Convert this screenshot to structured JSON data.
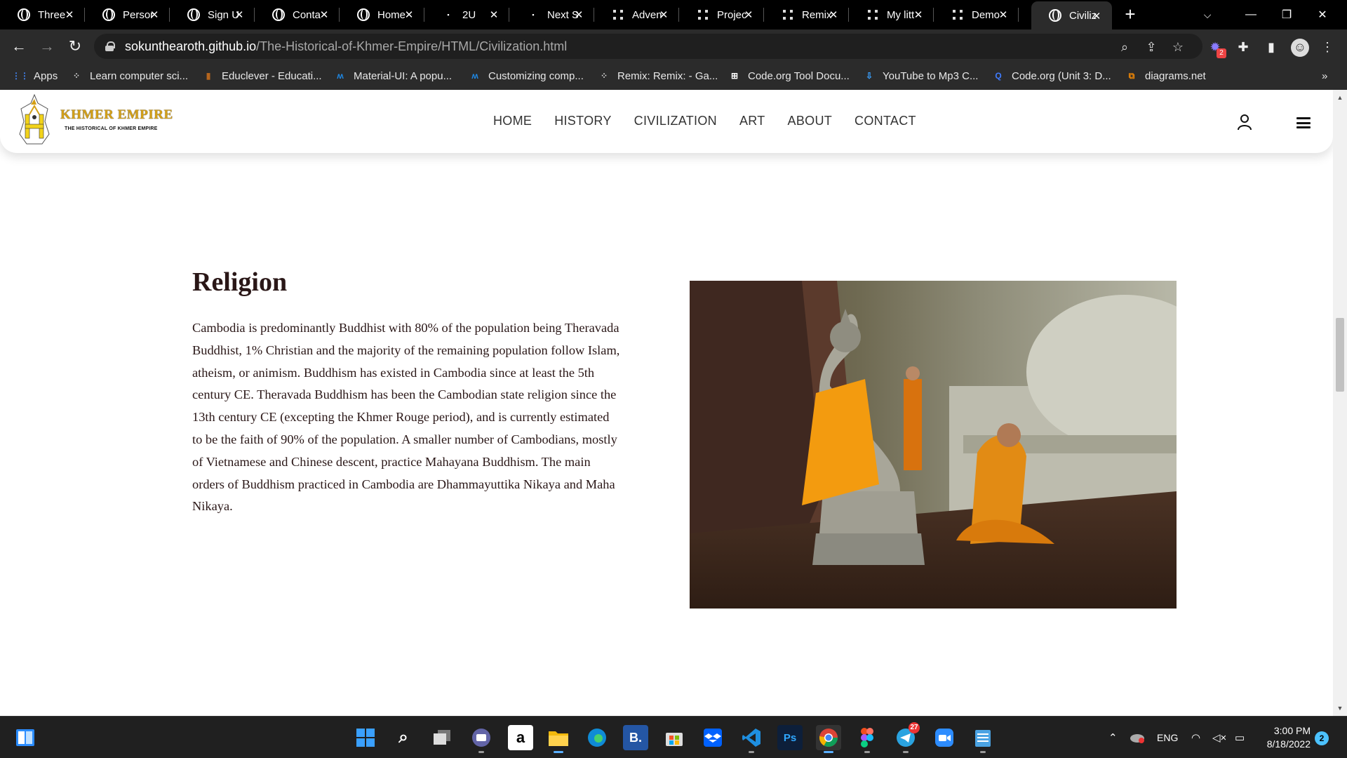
{
  "tabs": [
    {
      "title": "Three",
      "favicon": "globe-icon"
    },
    {
      "title": "Person",
      "favicon": "globe-icon"
    },
    {
      "title": "Sign U",
      "favicon": "globe-icon"
    },
    {
      "title": "Conta",
      "favicon": "globe-icon"
    },
    {
      "title": "Home",
      "favicon": "globe-icon"
    },
    {
      "title": "2U",
      "favicon": "2u-icon"
    },
    {
      "title": "Next S",
      "favicon": "next-icon"
    },
    {
      "title": "Adven",
      "favicon": "dots-icon"
    },
    {
      "title": "Projec",
      "favicon": "dots-icon"
    },
    {
      "title": "Remix",
      "favicon": "dots-icon"
    },
    {
      "title": "My litt",
      "favicon": "dots-icon"
    },
    {
      "title": "Demo",
      "favicon": "dots-icon"
    },
    {
      "title": "Civiliz",
      "favicon": "globe-icon",
      "active": true
    }
  ],
  "address": {
    "host": "sokunthearoth.github.io",
    "path": "/The-Historical-of-Khmer-Empire/HTML/Civilization.html"
  },
  "extensions": {
    "badge": "2"
  },
  "bookmarks": [
    {
      "label": "Apps",
      "icon": "apps-grid-icon"
    },
    {
      "label": "Learn computer sci...",
      "icon": "code-org-icon"
    },
    {
      "label": "Educlever - Educati...",
      "icon": "book-icon"
    },
    {
      "label": "Material-UI: A popu...",
      "icon": "mui-icon"
    },
    {
      "label": "Customizing comp...",
      "icon": "mui-icon"
    },
    {
      "label": "Remix: Remix: - Ga...",
      "icon": "code-org-icon"
    },
    {
      "label": "Code.org Tool Docu...",
      "icon": "grid-icon"
    },
    {
      "label": "YouTube to Mp3 C...",
      "icon": "download-icon"
    },
    {
      "label": "Code.org (Unit 3: D...",
      "icon": "q-icon"
    },
    {
      "label": "diagrams.net",
      "icon": "diagrams-icon"
    }
  ],
  "more_bookmarks": "»",
  "site": {
    "logo_title": "KHMER EMPIRE",
    "logo_subtitle": "THE HISTORICAL OF KHMER EMPIRE",
    "menu": [
      "HOME",
      "HISTORY",
      "CIVILIZATION",
      "ART",
      "ABOUT",
      "CONTACT"
    ]
  },
  "section": {
    "title": "Religion",
    "body": "Cambodia is predominantly Buddhist with 80% of the population being Theravada Buddhist, 1% Christian and the majority of the remaining population follow Islam, atheism, or animism. Buddhism has existed in Cambodia since at least the 5th century CE. Theravada Buddhism has been the Cambodian state religion since the 13th century CE (excepting the Khmer Rouge period), and is currently estimated to be the faith of 90% of the population. A smaller number of Cambodians, mostly of Vietnamese and Chinese descent, practice Mahayana Buddhism. The main orders of Buddhism practiced in Cambodia are Dhammayuttika Nikaya and Maha Nikaya."
  },
  "taskbar": {
    "apps": [
      "windows-start-icon",
      "search-icon",
      "task-view-icon",
      "teams-icon",
      "amazon-icon",
      "file-explorer-icon",
      "edge-icon",
      "booking-icon",
      "store-icon",
      "dropbox-icon",
      "vscode-icon",
      "photoshop-icon",
      "chrome-icon",
      "figma-icon",
      "telegram-icon",
      "zoom-icon",
      "notepad-icon"
    ],
    "telegram_badge": "27",
    "language": "ENG",
    "time": "3:00 PM",
    "date": "8/18/2022",
    "notifications": "2"
  },
  "colors": {
    "accent_gold": "#d4a017",
    "text_dark": "#2a1717",
    "chrome_dark": "#2b2b2b"
  }
}
